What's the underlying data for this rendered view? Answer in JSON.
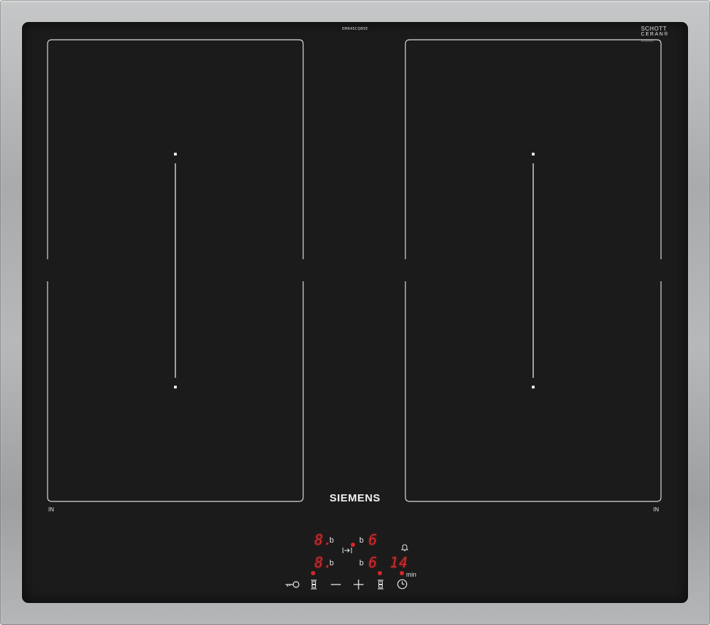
{
  "hob": {
    "model": "EM645CQB5E",
    "glass_brand_line1": "SCHOTT",
    "glass_brand_line2": "CERAN®",
    "glass_code": "001043201",
    "brand": "SIEMENS",
    "zone_left_label": "IN",
    "zone_right_label": "IN"
  },
  "display": {
    "front_left_level": "8.",
    "front_left_flag": "b",
    "rear_left_level": "8.",
    "rear_left_flag": "b",
    "front_right_flag": "b",
    "front_right_level": "6",
    "rear_right_flag": "b",
    "rear_right_level": "6",
    "timer_value": "14",
    "timer_unit": "min"
  },
  "controls": [
    {
      "name": "child-lock-key",
      "icon": "key-icon"
    },
    {
      "name": "select-left-zone",
      "icon": "zone-select-icon"
    },
    {
      "name": "minus",
      "icon": "minus-icon"
    },
    {
      "name": "plus",
      "icon": "plus-icon"
    },
    {
      "name": "select-right-zone",
      "icon": "zone-select-icon"
    },
    {
      "name": "timer",
      "icon": "clock-icon"
    }
  ],
  "colors": {
    "glass": "#1b1b1b",
    "led_red": "#d6282b",
    "print_white": "#e8e8e8",
    "frame_steel": "#b1b3b5"
  }
}
